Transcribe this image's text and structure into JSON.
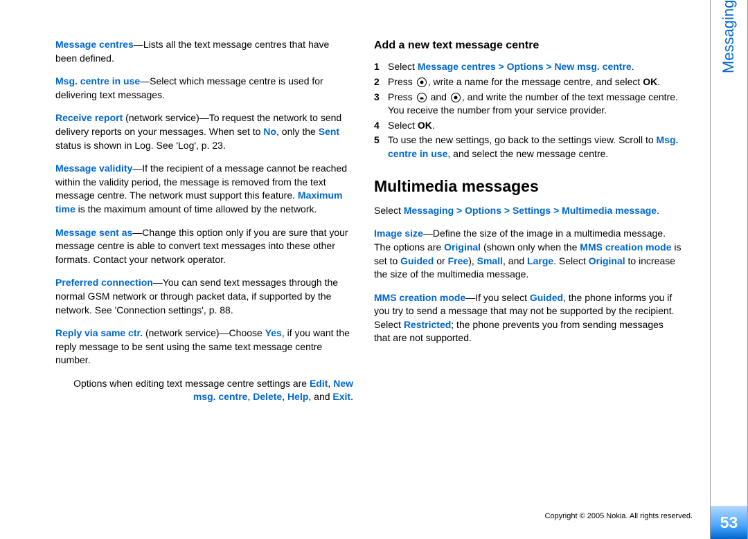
{
  "sidebar": {
    "label": "Messaging"
  },
  "page_number": "53",
  "copyright": "Copyright © 2005 Nokia. All rights reserved.",
  "left": {
    "p1": {
      "term": "Message centres",
      "rest": "—Lists all the text message centres that have been defined."
    },
    "p2": {
      "term": "Msg. centre in use",
      "rest": "—Select which message centre is used for delivering text messages."
    },
    "p3": {
      "term": "Receive report",
      "part1": " (network service)—To request the network to send delivery reports on your messages. When set to ",
      "no": "No",
      "part2": ", only the ",
      "sent": "Sent",
      "part3": " status is shown in Log. See 'Log', p. 23."
    },
    "p4": {
      "term": "Message validity",
      "part1": "—If the recipient of a message cannot be reached within the validity period, the message is removed from the text message centre. The network must support this feature. ",
      "max": "Maximum time",
      "part2": " is the maximum amount of time allowed by the network."
    },
    "p5": {
      "term": "Message sent as",
      "rest": "—Change this option only if you are sure that your message centre is able to convert text messages into these other formats. Contact your network operator."
    },
    "p6": {
      "term": "Preferred connection",
      "rest": "—You can send text messages through the normal GSM network or through packet data, if supported by the network. See 'Connection settings', p. 88."
    },
    "p7": {
      "term": "Reply via same ctr.",
      "part1": " (network service)—Choose ",
      "yes": "Yes",
      "part2": ", if you want the reply message to be sent using the same text message centre number."
    },
    "options": {
      "pre": "Options when editing text message centre settings are ",
      "edit": "Edit",
      "c1": ", ",
      "newmsg": "New msg. centre",
      "c2": ", ",
      "delete": "Delete",
      "c3": ", ",
      "help": "Help",
      "c4": ", and ",
      "exit": "Exit",
      "end": "."
    }
  },
  "right": {
    "h3": "Add a new text message centre",
    "li1": {
      "pre": "Select ",
      "path": "Message centres > Options > New msg. centre",
      "end": "."
    },
    "li2": {
      "pre": "Press ",
      "mid": ", write a name for the message centre, and select ",
      "ok": "OK",
      "end": "."
    },
    "li3": {
      "pre": "Press ",
      "and": " and ",
      "mid": ", and write the number of the text message centre. You receive the number from your service provider."
    },
    "li4": {
      "pre": "Select ",
      "ok": "OK",
      "end": "."
    },
    "li5": {
      "pre": "To use the new settings, go back to the settings view. Scroll to ",
      "msg": "Msg. centre in use",
      "end": ", and select the new message centre."
    },
    "h2": "Multimedia messages",
    "intro": {
      "pre": "Select ",
      "path": "Messaging > Options > Settings > Multimedia message",
      "end": "."
    },
    "pimg": {
      "term": "Image size",
      "p1": "—Define the size of the image in a multimedia message. The options are ",
      "orig": "Original",
      "p2": " (shown only when the ",
      "mms": "MMS creation mode",
      "p3": " is set to ",
      "guided": "Guided",
      "p4": " or ",
      "free": "Free",
      "p5": "), ",
      "small": "Small",
      "p6": ", and ",
      "large": "Large",
      "p7": ". Select ",
      "orig2": "Original",
      "p8": " to increase the size of the multimedia message."
    },
    "pmms": {
      "term": "MMS creation mode",
      "p1": "—If you select ",
      "guided": "Guided",
      "p2": ", the phone informs you if you try to send a message that may not be supported by the recipient. Select ",
      "restricted": "Restricted",
      "p3": "; the phone prevents you from sending messages that are not supported."
    }
  }
}
